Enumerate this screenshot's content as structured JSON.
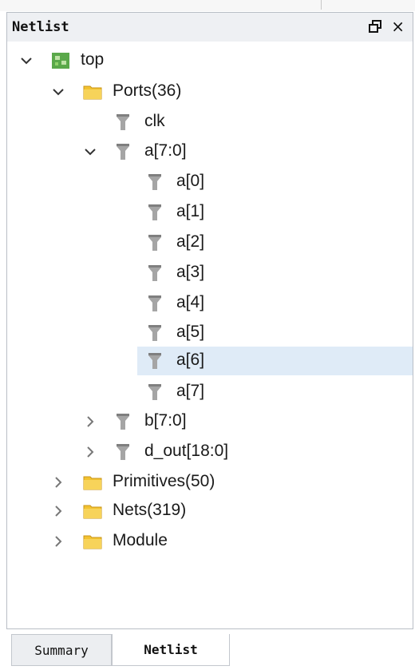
{
  "panel": {
    "title": "Netlist",
    "restore_label": "",
    "close_label": "×"
  },
  "tree": {
    "root": {
      "label": "top",
      "expanded": true
    },
    "ports": {
      "label": "Ports(36)",
      "expanded": true
    },
    "clk": {
      "label": "clk"
    },
    "a_bus": {
      "label": "a[7:0]",
      "expanded": true
    },
    "a_bits": [
      "a[0]",
      "a[1]",
      "a[2]",
      "a[3]",
      "a[4]",
      "a[5]",
      "a[6]",
      "a[7]"
    ],
    "selected_bit": "a[6]",
    "b_bus": {
      "label": "b[7:0]",
      "expanded": false
    },
    "d_out_bus": {
      "label": "d_out[18:0]",
      "expanded": false
    },
    "primitives": {
      "label": "Primitives(50)",
      "expanded": false
    },
    "nets": {
      "label": "Nets(319)",
      "expanded": false
    },
    "module": {
      "label": "Module",
      "expanded": false
    }
  },
  "tabs": {
    "summary": "Summary",
    "netlist": "Netlist",
    "active": "Netlist"
  },
  "colors": {
    "selection": "#dfebf7",
    "folder": "#f2c230",
    "module": "#5aa84a",
    "port": "#9a9a9a"
  }
}
